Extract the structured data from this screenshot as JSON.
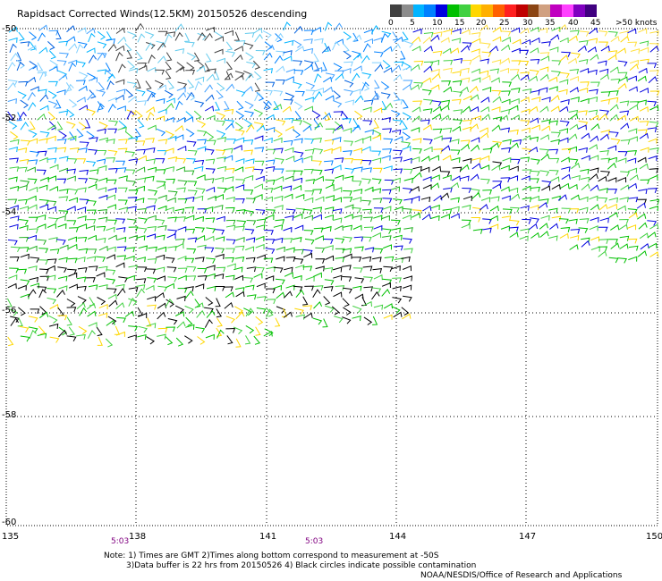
{
  "title": "Rapidsact Corrected Winds(12.5KM) 20150526 descending",
  "colorbar": {
    "colors": [
      "#404040",
      "#8c8c8c",
      "#00b4ff",
      "#0080ff",
      "#0000e0",
      "#00c000",
      "#40d040",
      "#ffd700",
      "#ffb000",
      "#ff6000",
      "#ff2020",
      "#c00000",
      "#8b4513",
      "#d0a080",
      "#c000c0",
      "#ff40ff",
      "#8000c0",
      "#400080"
    ],
    "labels": [
      "0",
      "5",
      "10",
      "15",
      "20",
      "25",
      "30",
      "35",
      "40",
      "45",
      ">50 knots"
    ]
  },
  "lat_labels": [
    "-50",
    "-52",
    "-54",
    "-56",
    "-58",
    "-60"
  ],
  "lon_labels": [
    "135",
    "138",
    "141",
    "144",
    "147",
    "150"
  ],
  "time_labels": [
    "5:03",
    "5:03"
  ],
  "notes": [
    "Note: 1) Times are GMT 2)Times along bottom correspond to measurement at -50S",
    "3)Data buffer is 22 hrs from 20150526 4) Black circles indicate possible contamination",
    "NOAA/NESDIS/Office of Research and Applications"
  ]
}
